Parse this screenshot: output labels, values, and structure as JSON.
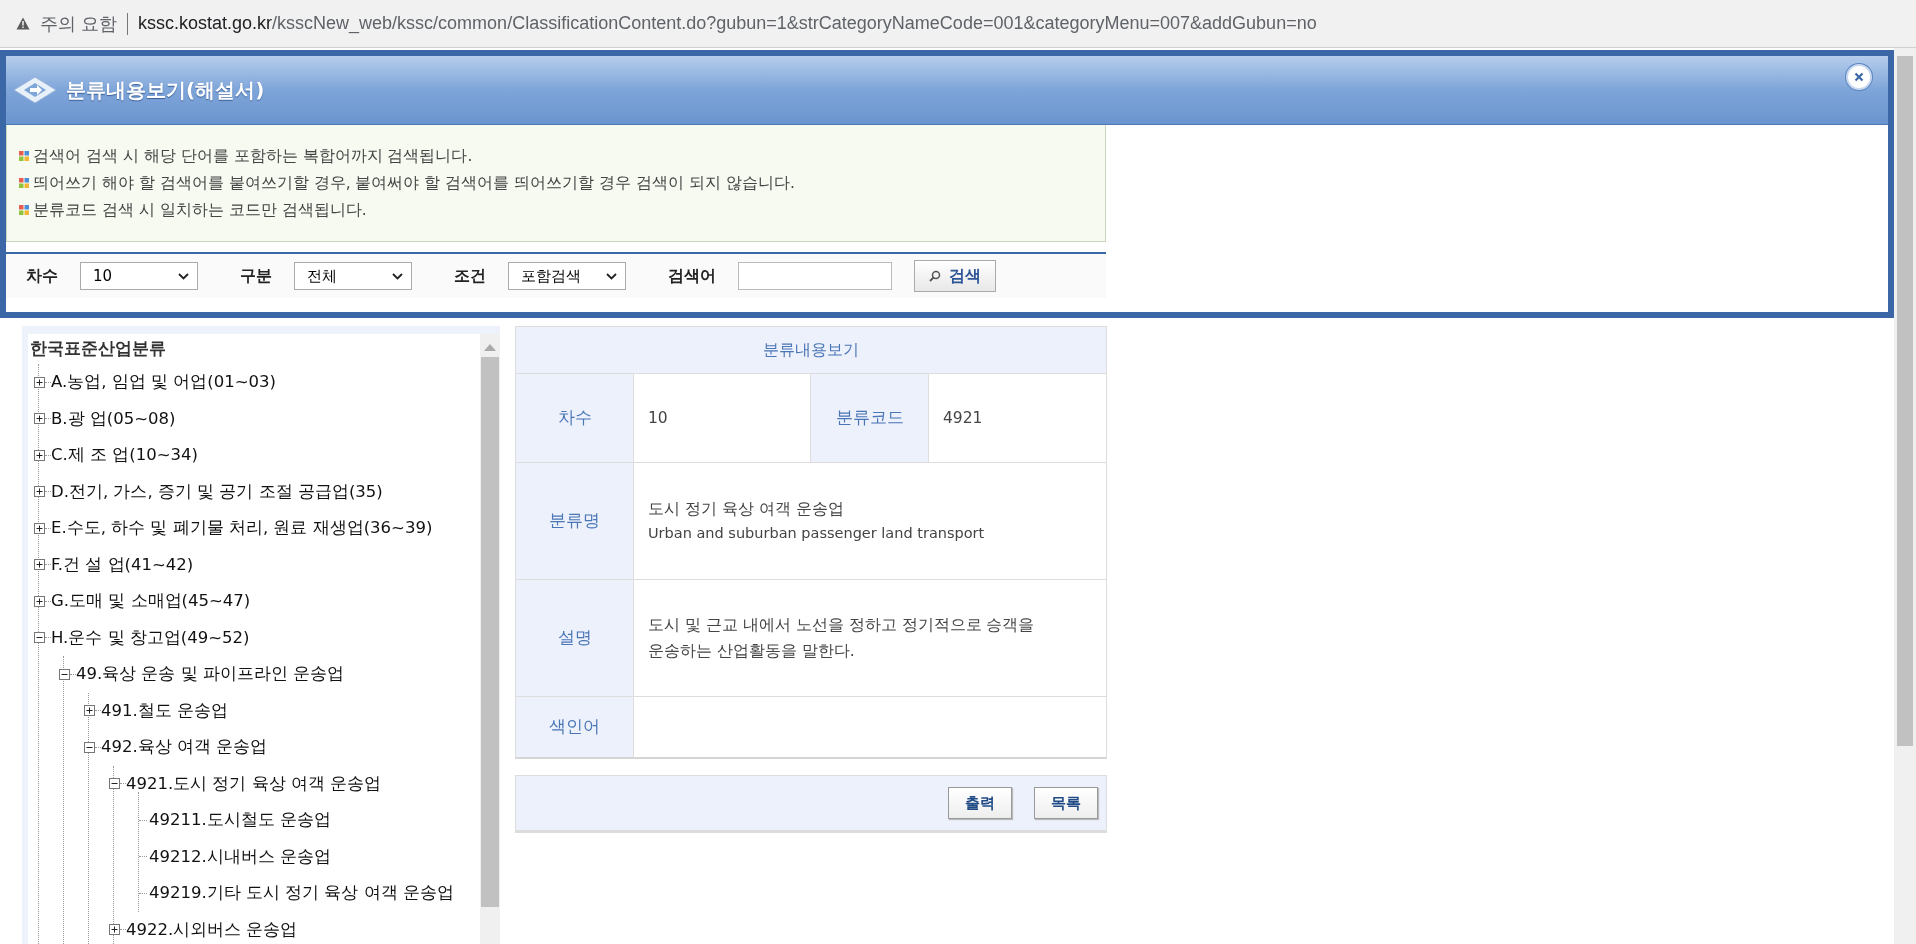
{
  "browser": {
    "security_label": "주의 요함",
    "url_host": "kssc.kostat.go.kr",
    "url_path": "/ksscNew_web/kssc/common/ClassificationContent.do?gubun=1&strCategoryNameCode=001&categoryMenu=007&addGubun=no"
  },
  "popup": {
    "title": "분류내용보기(해설서)",
    "notices": [
      "검색어 검색 시 해당 단어를 포함하는 복합어까지 검색됩니다.",
      "띄어쓰기 해야 할 검색어를 붙여쓰기할 경우, 붙여써야 할 검색어를 띄어쓰기할 경우 검색이 되지 않습니다.",
      "분류코드 검색 시 일치하는 코드만 검색됩니다."
    ],
    "filters": [
      {
        "label": "차수",
        "value": "10"
      },
      {
        "label": "구분",
        "value": "전체"
      },
      {
        "label": "조건",
        "value": "포함검색"
      }
    ],
    "keyword_label": "검색어",
    "search_button": "검색"
  },
  "tree": {
    "title": "한국표준산업분류",
    "items": [
      {
        "kind": "branch",
        "label": "A.농업, 임업 및 어업(01~03)",
        "expanded": false
      },
      {
        "kind": "branch",
        "label": "B.광 업(05~08)",
        "expanded": false
      },
      {
        "kind": "branch",
        "label": "C.제 조 업(10~34)",
        "expanded": false
      },
      {
        "kind": "branch",
        "label": "D.전기, 가스, 증기 및 공기 조절 공급업(35)",
        "expanded": false
      },
      {
        "kind": "branch",
        "label": "E.수도, 하수 및 폐기물 처리, 원료 재생업(36~39)",
        "expanded": false
      },
      {
        "kind": "branch",
        "label": "F.건 설 업(41~42)",
        "expanded": false
      },
      {
        "kind": "branch",
        "label": "G.도매 및 소매업(45~47)",
        "expanded": false
      },
      {
        "kind": "branch",
        "label": "H.운수 및 창고업(49~52)",
        "expanded": true,
        "children": [
          {
            "kind": "branch",
            "label": "49.육상 운송 및 파이프라인 운송업",
            "expanded": true,
            "children": [
              {
                "kind": "branch",
                "label": "491.철도 운송업",
                "expanded": false
              },
              {
                "kind": "branch",
                "label": "492.육상 여객 운송업",
                "expanded": true,
                "children": [
                  {
                    "kind": "branch",
                    "label": "4921.도시 정기 육상 여객 운송업",
                    "expanded": true,
                    "children": [
                      {
                        "kind": "leaf",
                        "label": "49211.도시철도 운송업"
                      },
                      {
                        "kind": "leaf",
                        "label": "49212.시내버스 운송업"
                      },
                      {
                        "kind": "leaf",
                        "label": "49219.기타 도시 정기 육상 여객 운송업"
                      }
                    ]
                  },
                  {
                    "kind": "branch",
                    "label": "4922.시외버스 운송업",
                    "expanded": false
                  }
                ]
              }
            ]
          }
        ]
      }
    ]
  },
  "detail": {
    "title": "분류내용보기",
    "version": {
      "label": "차수",
      "value": "10"
    },
    "code": {
      "label": "분류코드",
      "value": "4921"
    },
    "name": {
      "label": "분류명",
      "value_ko": "도시 정기 육상 여객 운송업",
      "value_en": "Urban and suburban passenger land transport"
    },
    "description": {
      "label": "설명",
      "value": "도시 및 근교 내에서 노선을 정하고 정기적으로 승객을 운송하는 산업활동을 말한다."
    },
    "index_terms": {
      "label": "색인어"
    },
    "buttons": [
      "출력",
      "목록"
    ]
  }
}
